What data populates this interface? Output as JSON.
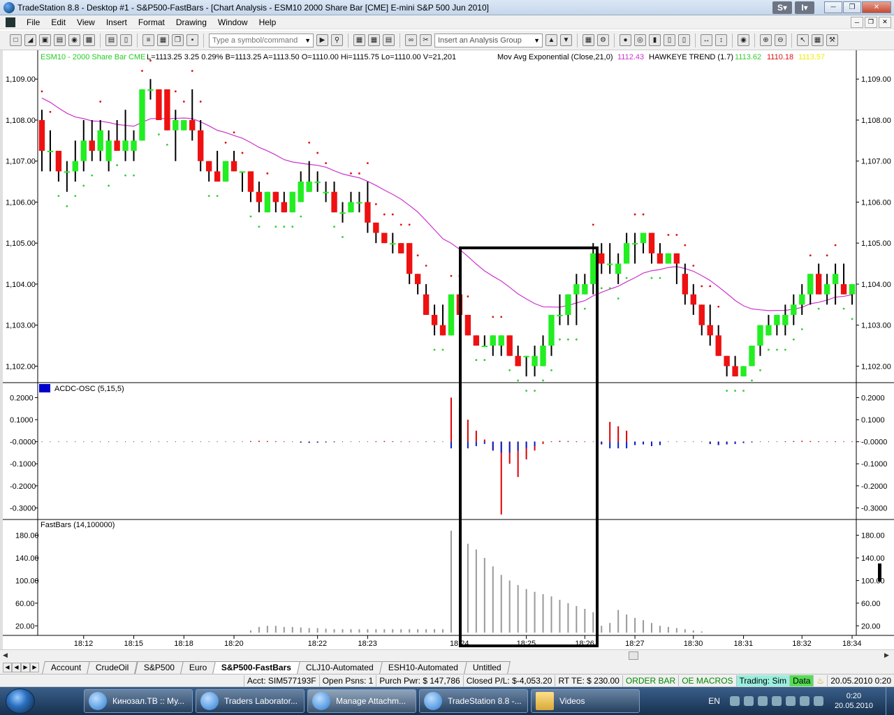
{
  "window": {
    "title": "TradeStation 8.8 - Desktop #1 - S&P500-FastBars - [Chart Analysis - ESM10 2000 Share Bar [CME] E-mini S&P 500 Jun 2010]",
    "badge_s": "S",
    "badge_i": "I"
  },
  "menu": [
    "File",
    "Edit",
    "View",
    "Insert",
    "Format",
    "Drawing",
    "Window",
    "Help"
  ],
  "toolbar": {
    "symbol_placeholder": "Type a symbol/command",
    "analysis_group": "Insert an Analysis Group"
  },
  "chart": {
    "symbol_label": "ESM10 - 2000 Share Bar  CME",
    "quote": "L=1113.25  3.25    0.29%   B=1113.25  A=1113.50  O=1110.00  Hi=1115.75  Lo=1110.00  V=21,201",
    "mov_avg_label": "Mov Avg Exponential (Close,21,0)",
    "mov_avg_value": "1112.43",
    "hawkeye_label": "HAWKEYE TREND (1.7)",
    "hawkeye_v1": "1113.62",
    "hawkeye_v2": "1110.18",
    "hawkeye_v3": "1113.57",
    "acdc_label": "ACDC-OSC (5,15,5)",
    "fastbars_label": "FastBars (14,100000)",
    "colors": {
      "up": "#22ee22",
      "down": "#ee1111",
      "ma": "#cc33cc",
      "hawkeye_green": "#33cc33",
      "hawkeye_red": "#dd1111",
      "hawkeye_yellow": "#eeee00",
      "osc_red": "#dd0000",
      "osc_blue": "#0022cc",
      "fastbars": "#999999"
    }
  },
  "chart_data": [
    {
      "type": "candlestick",
      "title": "",
      "y_ticks": [
        "1,109.00",
        "1,108.00",
        "1,107.00",
        "1,106.00",
        "1,105.00",
        "1,104.00",
        "1,103.00",
        "1,102.00"
      ],
      "ylim": [
        1101.7,
        1109.6
      ],
      "x_ticks": [
        "18:12",
        "18:15",
        "18:18",
        "18:20",
        "18:22",
        "18:23",
        "18:24",
        "18:25",
        "18:26",
        "18:27",
        "18:30",
        "18:31",
        "18:32",
        "18:34"
      ],
      "bars": [
        [
          1108.0,
          1108.25,
          1106.75,
          1107.25
        ],
        [
          1107.25,
          1107.75,
          1106.75,
          1107.25
        ],
        [
          1107.25,
          1107.25,
          1106.5,
          1106.75
        ],
        [
          1106.75,
          1107.0,
          1106.25,
          1106.75
        ],
        [
          1106.75,
          1107.5,
          1106.5,
          1107.0
        ],
        [
          1107.0,
          1108.0,
          1106.75,
          1107.5
        ],
        [
          1107.5,
          1108.0,
          1107.0,
          1107.25
        ],
        [
          1107.25,
          1108.0,
          1107.0,
          1107.75
        ],
        [
          1107.0,
          1107.75,
          1106.75,
          1107.5
        ],
        [
          1107.5,
          1108.0,
          1107.25,
          1107.25
        ],
        [
          1107.25,
          1108.25,
          1107.0,
          1107.5
        ],
        [
          1107.25,
          1107.75,
          1107.0,
          1107.5
        ],
        [
          1107.5,
          1108.75,
          1107.5,
          1108.75
        ],
        [
          1108.75,
          1109.0,
          1108.5,
          1108.75
        ],
        [
          1108.75,
          1108.75,
          1108.0,
          1108.0
        ],
        [
          1108.75,
          1108.75,
          1107.75,
          1107.75
        ],
        [
          1107.75,
          1108.25,
          1107.0,
          1108.0
        ],
        [
          1107.75,
          1108.0,
          1107.75,
          1108.0
        ],
        [
          1108.0,
          1108.75,
          1107.5,
          1107.75
        ],
        [
          1107.75,
          1108.0,
          1106.75,
          1107.0
        ],
        [
          1107.0,
          1107.0,
          1106.5,
          1106.75
        ],
        [
          1106.75,
          1107.25,
          1106.5,
          1106.5
        ],
        [
          1106.5,
          1107.0,
          1106.5,
          1107.0
        ],
        [
          1107.0,
          1107.25,
          1106.75,
          1106.75
        ],
        [
          1106.75,
          1106.75,
          1106.25,
          1106.75
        ],
        [
          1106.75,
          1106.75,
          1106.0,
          1106.25
        ],
        [
          1106.25,
          1106.5,
          1105.75,
          1106.0
        ],
        [
          1105.75,
          1106.25,
          1105.75,
          1106.25
        ],
        [
          1106.25,
          1106.25,
          1105.75,
          1106.0
        ],
        [
          1106.0,
          1106.25,
          1105.75,
          1105.75
        ],
        [
          1105.75,
          1106.25,
          1105.75,
          1106.25
        ],
        [
          1106.0,
          1106.75,
          1106.0,
          1106.5
        ],
        [
          1106.25,
          1107.0,
          1106.25,
          1106.5
        ],
        [
          1106.5,
          1106.75,
          1106.25,
          1106.5
        ],
        [
          1106.25,
          1106.5,
          1106.0,
          1106.25
        ],
        [
          1106.25,
          1106.5,
          1105.75,
          1105.75
        ],
        [
          1105.75,
          1106.0,
          1105.5,
          1105.75
        ],
        [
          1105.75,
          1106.25,
          1105.75,
          1106.0
        ],
        [
          1106.0,
          1106.25,
          1105.75,
          1106.0
        ],
        [
          1106.0,
          1106.5,
          1105.25,
          1105.5
        ],
        [
          1105.5,
          1105.5,
          1105.0,
          1105.25
        ],
        [
          1105.25,
          1105.25,
          1105.0,
          1105.0
        ],
        [
          1105.0,
          1105.25,
          1104.75,
          1105.0
        ],
        [
          1105.0,
          1105.0,
          1104.75,
          1104.75
        ],
        [
          1105.0,
          1105.0,
          1104.0,
          1104.25
        ],
        [
          1104.25,
          1104.25,
          1103.75,
          1104.0
        ],
        [
          1103.75,
          1104.0,
          1103.25,
          1103.25
        ],
        [
          1103.25,
          1103.5,
          1102.75,
          1103.0
        ],
        [
          1103.0,
          1103.5,
          1102.75,
          1102.75
        ],
        [
          1102.75,
          1103.75,
          1102.75,
          1103.75
        ],
        [
          1103.75,
          1103.75,
          1103.25,
          1103.25
        ],
        [
          1103.25,
          1103.25,
          1102.75,
          1102.75
        ],
        [
          1102.75,
          1102.75,
          1102.5,
          1102.5
        ],
        [
          1102.5,
          1102.75,
          1102.5,
          1102.5
        ],
        [
          1102.5,
          1102.75,
          1102.25,
          1102.75
        ],
        [
          1102.5,
          1102.75,
          1102.25,
          1102.75
        ],
        [
          1102.75,
          1102.75,
          1102.25,
          1102.25
        ],
        [
          1102.25,
          1102.5,
          1102.0,
          1102.0
        ],
        [
          1102.25,
          1102.25,
          1101.75,
          1102.25
        ],
        [
          1102.0,
          1102.5,
          1101.75,
          1102.25
        ],
        [
          1102.0,
          1102.75,
          1102.0,
          1102.5
        ],
        [
          1102.5,
          1103.25,
          1102.25,
          1103.25
        ],
        [
          1103.25,
          1103.75,
          1103.0,
          1103.25
        ],
        [
          1103.25,
          1103.75,
          1103.0,
          1103.75
        ],
        [
          1103.75,
          1104.25,
          1103.0,
          1104.0
        ],
        [
          1103.75,
          1104.25,
          1103.75,
          1104.0
        ],
        [
          1104.0,
          1105.0,
          1103.75,
          1104.75
        ],
        [
          1104.75,
          1105.0,
          1104.25,
          1104.5
        ],
        [
          1104.5,
          1105.0,
          1104.25,
          1104.5
        ],
        [
          1104.25,
          1104.75,
          1104.0,
          1104.5
        ],
        [
          1104.5,
          1105.25,
          1104.5,
          1105.0
        ],
        [
          1105.0,
          1105.25,
          1104.5,
          1105.0
        ],
        [
          1105.0,
          1105.25,
          1104.75,
          1105.25
        ],
        [
          1105.25,
          1105.25,
          1104.5,
          1104.75
        ],
        [
          1104.75,
          1105.0,
          1104.5,
          1104.5
        ],
        [
          1104.5,
          1104.75,
          1104.5,
          1104.75
        ],
        [
          1104.75,
          1104.75,
          1104.0,
          1104.5
        ],
        [
          1104.25,
          1104.5,
          1103.5,
          1103.75
        ],
        [
          1103.75,
          1104.0,
          1103.25,
          1103.5
        ],
        [
          1103.5,
          1103.5,
          1102.75,
          1103.0
        ],
        [
          1103.0,
          1103.5,
          1102.5,
          1102.75
        ],
        [
          1102.75,
          1103.0,
          1102.25,
          1102.25
        ],
        [
          1102.25,
          1102.25,
          1101.75,
          1102.0
        ],
        [
          1102.0,
          1102.25,
          1101.75,
          1101.75
        ],
        [
          1101.75,
          1102.0,
          1101.75,
          1102.0
        ],
        [
          1102.0,
          1102.5,
          1102.0,
          1102.5
        ],
        [
          1102.5,
          1103.0,
          1102.25,
          1103.0
        ],
        [
          1102.75,
          1103.25,
          1102.75,
          1103.0
        ],
        [
          1103.0,
          1103.25,
          1102.75,
          1103.25
        ],
        [
          1103.0,
          1103.5,
          1102.75,
          1103.25
        ],
        [
          1103.25,
          1103.75,
          1103.0,
          1103.5
        ],
        [
          1103.5,
          1104.0,
          1103.25,
          1103.75
        ],
        [
          1103.75,
          1104.25,
          1103.5,
          1104.25
        ],
        [
          1104.25,
          1104.5,
          1103.75,
          1103.75
        ],
        [
          1103.75,
          1104.25,
          1103.5,
          1104.0
        ],
        [
          1104.0,
          1104.5,
          1103.5,
          1104.25
        ],
        [
          1104.0,
          1104.5,
          1103.75,
          1103.75
        ],
        [
          1103.75,
          1104.0,
          1103.5,
          1104.0
        ]
      ]
    },
    {
      "type": "bar",
      "title": "",
      "y_ticks": [
        "0.2000",
        "0.1000",
        "-0.0000",
        "-0.1000",
        "-0.2000",
        "-0.3000"
      ],
      "ylim": [
        -0.34,
        0.23
      ],
      "values": [
        0,
        0,
        0,
        0,
        0,
        0,
        0,
        0,
        0,
        0,
        0,
        0,
        0,
        0,
        0,
        0,
        0,
        0,
        0,
        0,
        0,
        0,
        0,
        0,
        0,
        0.003,
        0.004,
        0.003,
        0.002,
        0.001,
        0,
        -0.004,
        -0.005,
        -0.004,
        -0.003,
        -0.002,
        0,
        0,
        0,
        0,
        0.002,
        0.003,
        0.002,
        0.001,
        0.001,
        0,
        0.001,
        0.001,
        0.0,
        0.2,
        0.15,
        0.1,
        0.05,
        0.01,
        -0.04,
        -0.33,
        -0.1,
        -0.16,
        -0.08,
        -0.04,
        -0.01,
        0.002,
        0.004,
        0.003,
        0.002,
        0.001,
        0.0,
        -0.012,
        0.09,
        0.07,
        0.05,
        -0.015,
        -0.012,
        -0.02,
        -0.015,
        0,
        0,
        0,
        0,
        0,
        -0.01,
        -0.015,
        -0.012,
        -0.01,
        -0.006,
        -0.003,
        0,
        0,
        0,
        0.002,
        0.003,
        0.004,
        0.003,
        0.002,
        0.001,
        0.002,
        0.001,
        0.001,
        0.001,
        0.0,
        0.0
      ],
      "blue_values": [
        0,
        0,
        0,
        0,
        0,
        0,
        0,
        0,
        0,
        0,
        0,
        0,
        0,
        0,
        0,
        0,
        0,
        0,
        0,
        0,
        0,
        0,
        0,
        0,
        0,
        0,
        0,
        0,
        0,
        0,
        0,
        -0.004,
        -0.005,
        -0.004,
        -0.003,
        -0.002,
        0,
        0,
        0,
        0,
        0,
        0,
        0,
        0,
        0,
        0,
        0,
        0,
        0,
        -0.03,
        -0.03,
        -0.03,
        -0.02,
        -0.01,
        -0.04,
        -0.05,
        -0.05,
        -0.04,
        -0.03,
        -0.02,
        0,
        0,
        0,
        0,
        0,
        0,
        0,
        -0.012,
        -0.03,
        -0.03,
        -0.03,
        -0.015,
        -0.012,
        -0.02,
        -0.015,
        0,
        0,
        0,
        0,
        0,
        -0.01,
        -0.015,
        -0.012,
        -0.01,
        -0.006,
        -0.003,
        0,
        0,
        0,
        0,
        0,
        0,
        0,
        0,
        0,
        0,
        0,
        0,
        0,
        0,
        0
      ]
    },
    {
      "type": "bar",
      "title": "",
      "y_ticks": [
        "180.00",
        "140.00",
        "100.00",
        "60.00",
        "20.00"
      ],
      "ylim": [
        8,
        198
      ],
      "values": [
        0,
        0,
        0,
        0,
        0,
        0,
        0,
        0,
        0,
        0,
        0,
        0,
        0,
        0,
        0,
        0,
        0,
        0,
        0,
        0,
        0,
        0,
        0,
        0,
        0,
        12,
        18,
        20,
        20,
        18,
        18,
        17,
        16,
        16,
        15,
        14,
        14,
        14,
        14,
        14,
        14,
        14,
        14,
        14,
        14,
        14,
        14,
        14,
        14,
        188,
        175,
        165,
        155,
        140,
        125,
        110,
        100,
        92,
        85,
        80,
        76,
        72,
        66,
        60,
        55,
        50,
        44,
        20,
        25,
        48,
        40,
        34,
        30,
        25,
        20,
        18,
        16,
        14,
        12,
        10,
        8,
        8,
        8,
        8,
        8,
        8,
        8,
        8,
        8,
        8,
        8,
        8,
        8,
        8,
        8,
        8,
        8,
        8,
        8,
        8,
        8,
        8,
        8,
        8
      ]
    }
  ],
  "tabs": [
    "Account",
    "CrudeOil",
    "S&P500",
    "Euro",
    "S&P500-FastBars",
    "CLJ10-Automated",
    "ESH10-Automated",
    "Untitled"
  ],
  "active_tab": "S&P500-FastBars",
  "status": {
    "acct": "Acct: SIM577193F",
    "open_psns": "Open Psns: 1",
    "purch_pwr": "Purch Pwr: $ 147,786",
    "closed_pl": "Closed P/L: $-4,053.20",
    "rt_te": "RT TE: $ 230.00",
    "order_bar": "ORDER BAR",
    "oe_macros": "OE MACROS",
    "trading": "Trading: Sim",
    "data": "Data",
    "datetime": "20.05.2010 0:20"
  },
  "taskbar": {
    "items": [
      "Кинозал.ТВ :: Му...",
      "Traders Laborator...",
      "Manage Attachm...",
      "TradeStation 8.8 -...",
      "Videos"
    ],
    "lang": "EN",
    "time": "0:20",
    "date": "20.05.2010"
  }
}
